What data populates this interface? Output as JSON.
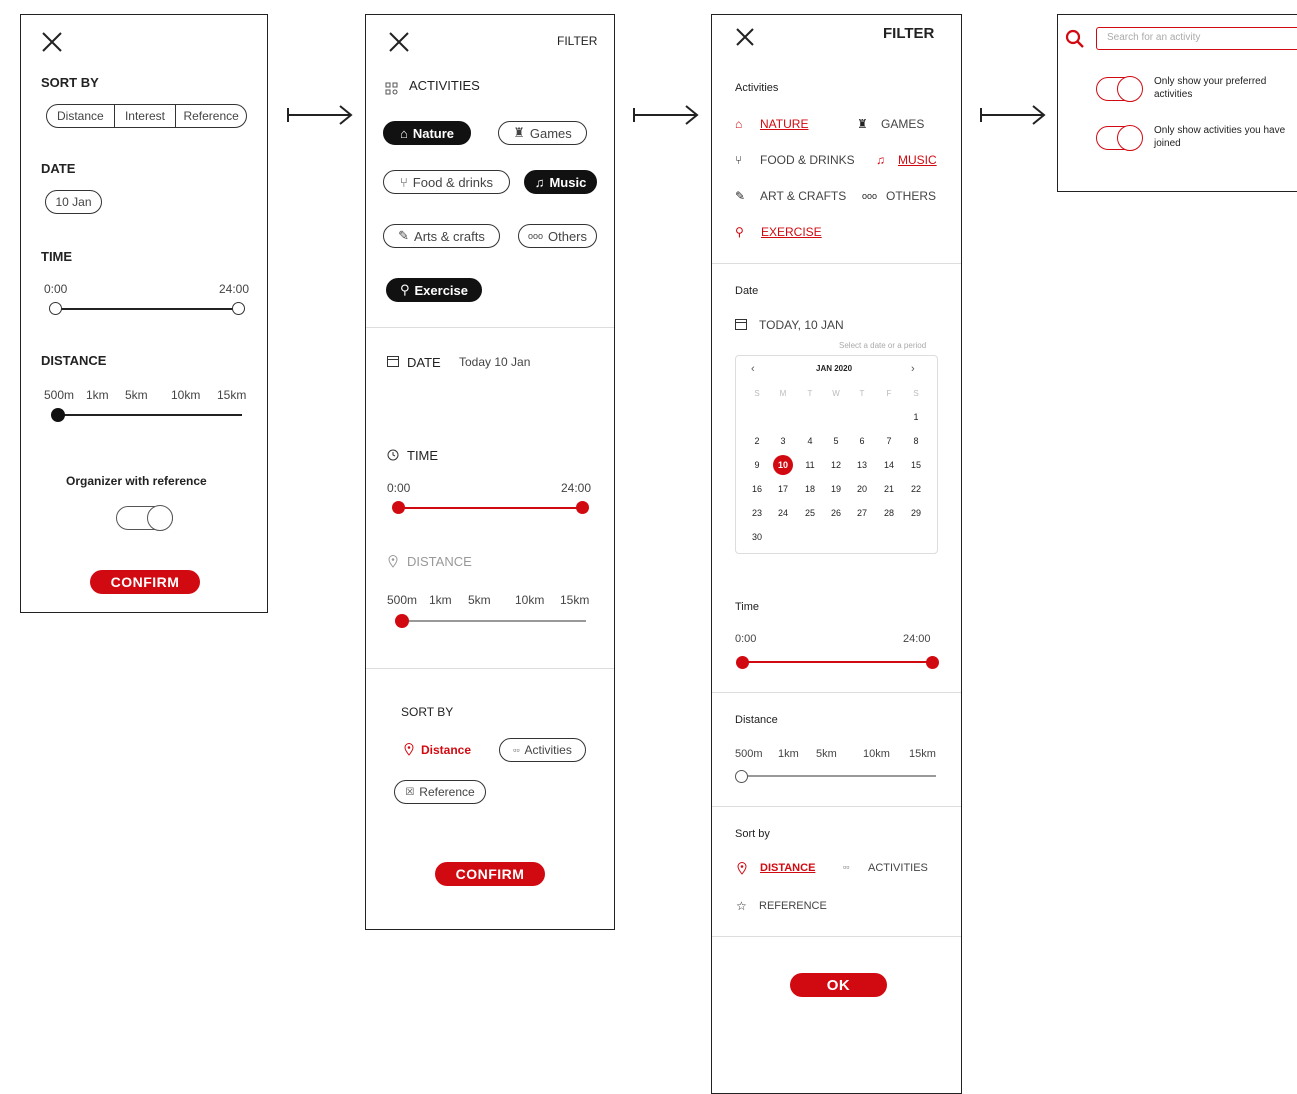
{
  "screen1": {
    "sort_by": "SORT BY",
    "sort_options": [
      "Distance",
      "Interest",
      "Reference"
    ],
    "date_label": "DATE",
    "date_value": "10 Jan",
    "time_label": "TIME",
    "time_min": "0:00",
    "time_max": "24:00",
    "distance_label": "DISTANCE",
    "distance_ticks": [
      "500m",
      "1km",
      "5km",
      "10km",
      "15km"
    ],
    "organizer_label": "Organizer with reference",
    "confirm": "CONFIRM"
  },
  "screen2": {
    "title": "FILTER",
    "activities_label": "ACTIVITIES",
    "chips": [
      "Nature",
      "Games",
      "Food & drinks",
      "Music",
      "Arts & crafts",
      "Others",
      "Exercise"
    ],
    "date_label": "DATE",
    "date_value": "Today 10 Jan",
    "time_label": "TIME",
    "time_min": "0:00",
    "time_max": "24:00",
    "distance_label": "DISTANCE",
    "distance_ticks": [
      "500m",
      "1km",
      "5km",
      "10km",
      "15km"
    ],
    "sort_by": "SORT BY",
    "sort_distance": "Distance",
    "sort_activities": "Activities",
    "sort_reference": "Reference",
    "confirm": "CONFIRM"
  },
  "screen3": {
    "title": "FILTER",
    "activities_label": "Activities",
    "nature": "NATURE",
    "games": "GAMES",
    "food": "FOOD & DRINKS",
    "music": "MUSIC",
    "art": "ART & CRAFTS",
    "others": "OTHERS",
    "exercise": "EXERCISE",
    "date_label": "Date",
    "date_value": "TODAY, 10 JAN",
    "date_hint": "Select a date or a period",
    "calendar": {
      "month": "JAN 2020",
      "weekdays": [
        "S",
        "M",
        "T",
        "W",
        "T",
        "F",
        "S"
      ],
      "weeks": [
        [
          "",
          "",
          "",
          "",
          "",
          "",
          "1"
        ],
        [
          "2",
          "3",
          "4",
          "5",
          "6",
          "7",
          "8"
        ],
        [
          "9",
          "10",
          "11",
          "12",
          "13",
          "14",
          "15"
        ],
        [
          "16",
          "17",
          "18",
          "19",
          "20",
          "21",
          "22"
        ],
        [
          "23",
          "24",
          "25",
          "26",
          "27",
          "28",
          "29"
        ],
        [
          "30",
          "",
          "",
          "",
          "",
          "",
          ""
        ]
      ],
      "selected": "10"
    },
    "time_label": "Time",
    "time_min": "0:00",
    "time_max": "24:00",
    "distance_label": "Distance",
    "distance_ticks": [
      "500m",
      "1km",
      "5km",
      "10km",
      "15km"
    ],
    "sort_label": "Sort by",
    "sort_distance": "DISTANCE",
    "sort_activities": "ACTIVITIES",
    "sort_reference": "REFERENCE",
    "ok": "OK"
  },
  "screen4": {
    "search_placeholder": "Search for an activity",
    "toggle1": "Only show your preferred activities",
    "toggle2": "Only show activities you have joined"
  },
  "colors": {
    "accent": "#d10a11",
    "dark": "#111111"
  }
}
